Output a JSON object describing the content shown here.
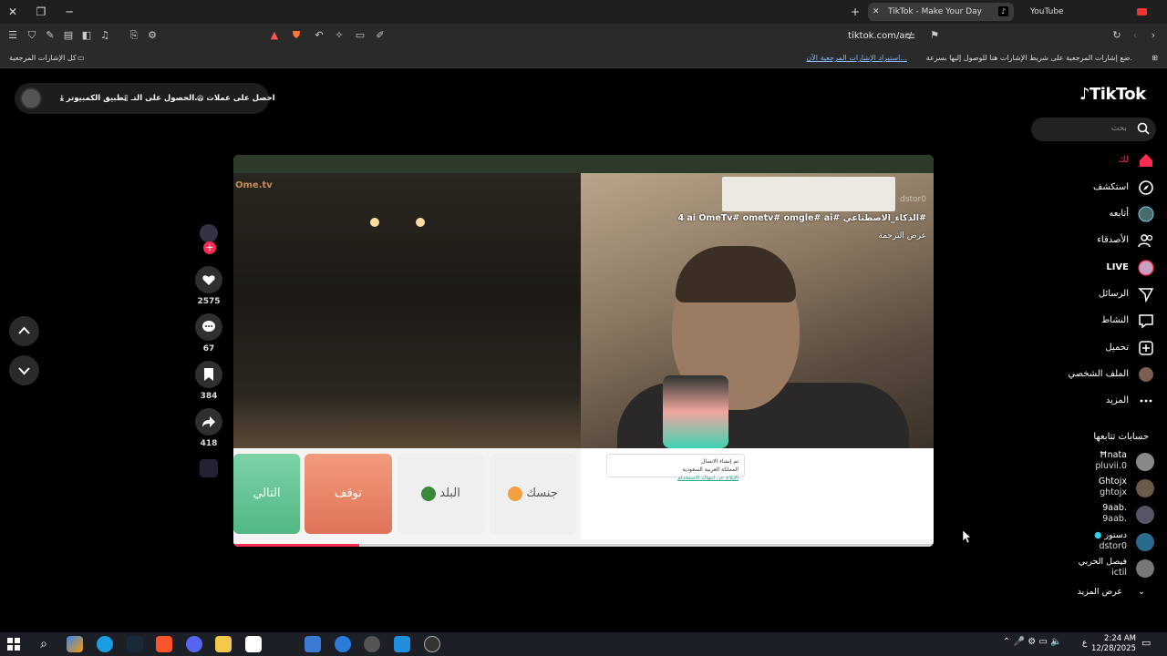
{
  "browser": {
    "tabs": [
      {
        "label": "TikTok - Make Your Day",
        "active": true
      },
      {
        "label": "YouTube",
        "active": false
      }
    ],
    "url": "tiktok.com/ar/",
    "bookmarks_bar": {
      "prompt": "ضع إشارات المرجعية على شريط الإشارات هنا للوصول إليها بسرعة.",
      "import_link": "استيراد الإشارات المرجعية الآن...",
      "all_bookmarks": "كل الإشارات المرجعية"
    }
  },
  "top_pill": {
    "coins": "احصل على عملات",
    "get_app": "الحصول على التـ...",
    "desktop_app": "تطبيق الكمبيوتر"
  },
  "logo": "TikTok",
  "search": {
    "placeholder": "بحث"
  },
  "sidebar": {
    "items": [
      {
        "label": "لك",
        "icon": "home-icon",
        "active": true
      },
      {
        "label": "استكشف",
        "icon": "compass-icon"
      },
      {
        "label": "أتابعه",
        "icon": "following-avatar-icon"
      },
      {
        "label": "الأصدقاء",
        "icon": "friends-icon"
      },
      {
        "label": "LIVE",
        "icon": "live-icon"
      },
      {
        "label": "الرسائل",
        "icon": "send-icon"
      },
      {
        "label": "النشاط",
        "icon": "activity-icon"
      },
      {
        "label": "تحميل",
        "icon": "upload-icon"
      },
      {
        "label": "الملف الشخصي",
        "icon": "profile-avatar-icon"
      },
      {
        "label": "المزيد",
        "icon": "more-icon"
      }
    ],
    "following_title": "حسابات تتابعها",
    "accounts": [
      {
        "name": "Ħnata",
        "handle": "pluvii.0"
      },
      {
        "name": "Ghtojx",
        "handle": "ghtojx"
      },
      {
        "name": "9aab.",
        "handle": "9aab."
      },
      {
        "name": "دستور",
        "handle": "dstor0"
      },
      {
        "name": "فيصل الحربي",
        "handle": "ictil"
      }
    ],
    "see_more": "عرض المزيد"
  },
  "video": {
    "site_logo": "Ome.tv",
    "buttons": {
      "next": "التالي",
      "stop": "توقف",
      "country": "البلد",
      "gender": "جنسك"
    },
    "notification": {
      "line1": "تم إنشاء الاتصال",
      "line2": "الإبلاغ عن انتهاك الاستخدام",
      "line3": "المملكة العربية السعودية"
    },
    "username": "dstor0",
    "caption": "4 ai OmeTv# ometv# omgle# ai# الذكاء_الاصطناعي#",
    "translate": "عرض الترجمة",
    "progress": 0.18
  },
  "actions": {
    "likes": "2575",
    "comments": "67",
    "saves": "384",
    "shares": "418"
  },
  "taskbar": {
    "time": "2:24 AM",
    "date": "12/28/2025",
    "lang": "ع"
  }
}
